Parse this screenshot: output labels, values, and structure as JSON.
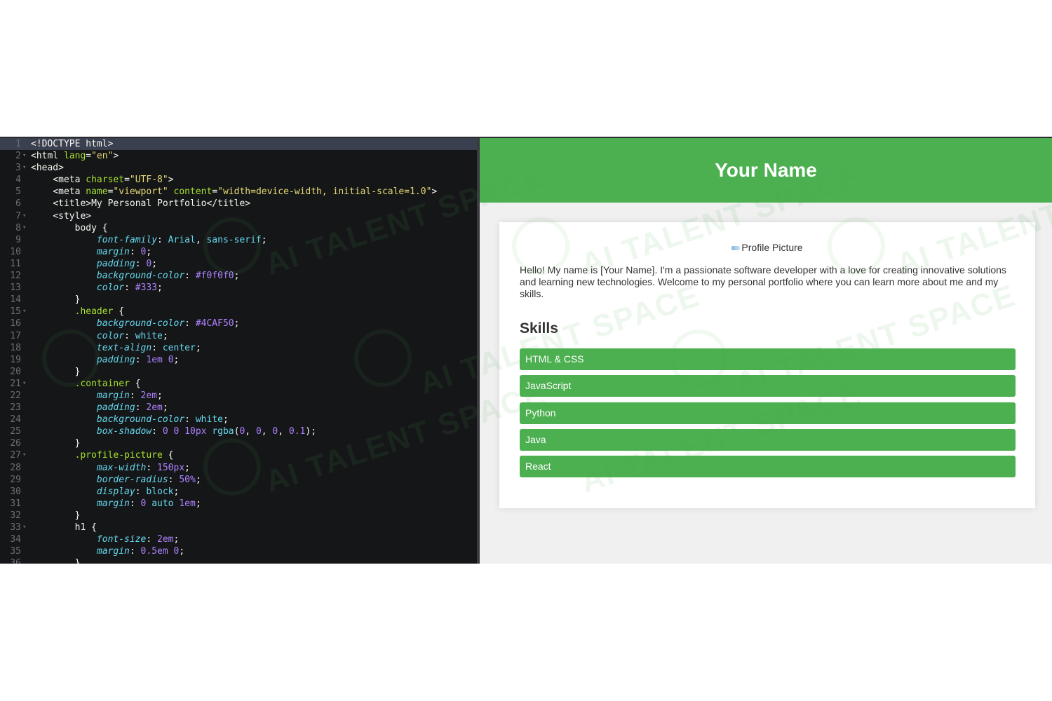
{
  "editor": {
    "lines": [
      {
        "n": "1",
        "fold": "",
        "active": true,
        "html": "<span class='t-tag'>&lt;!DOCTYPE html&gt;</span>"
      },
      {
        "n": "2",
        "fold": "▾",
        "html": "<span class='t-tag'>&lt;html </span><span class='t-attr'>lang</span><span class='t-punc'>=</span><span class='t-str'>\"en\"</span><span class='t-tag'>&gt;</span>"
      },
      {
        "n": "3",
        "fold": "▾",
        "html": "<span class='t-tag'>&lt;head&gt;</span>"
      },
      {
        "n": "4",
        "fold": "",
        "html": "    <span class='t-tag'>&lt;meta </span><span class='t-attr'>charset</span><span class='t-punc'>=</span><span class='t-str'>\"UTF-8\"</span><span class='t-tag'>&gt;</span>"
      },
      {
        "n": "5",
        "fold": "",
        "html": "    <span class='t-tag'>&lt;meta </span><span class='t-attr'>name</span><span class='t-punc'>=</span><span class='t-str'>\"viewport\"</span> <span class='t-attr'>content</span><span class='t-punc'>=</span><span class='t-str'>\"width=device-width, initial-scale=1.0\"</span><span class='t-tag'>&gt;</span>"
      },
      {
        "n": "6",
        "fold": "",
        "html": "    <span class='t-tag'>&lt;title&gt;</span>My Personal Portfolio<span class='t-tag'>&lt;/title&gt;</span>"
      },
      {
        "n": "7",
        "fold": "▾",
        "html": "    <span class='t-tag'>&lt;style&gt;</span>"
      },
      {
        "n": "8",
        "fold": "▾",
        "html": "        <span class='t-tag'>body</span> {"
      },
      {
        "n": "9",
        "fold": "",
        "html": "            <span class='t-prop'>font-family</span>: <span class='t-val'>Arial</span>, <span class='t-val'>sans-serif</span>;"
      },
      {
        "n": "10",
        "fold": "",
        "html": "            <span class='t-prop'>margin</span>: <span class='t-num'>0</span>;"
      },
      {
        "n": "11",
        "fold": "",
        "html": "            <span class='t-prop'>padding</span>: <span class='t-num'>0</span>;"
      },
      {
        "n": "12",
        "fold": "",
        "html": "            <span class='t-prop'>background-color</span>: <span class='t-hex'>#f0f0f0</span>;"
      },
      {
        "n": "13",
        "fold": "",
        "html": "            <span class='t-prop'>color</span>: <span class='t-hex'>#333</span>;"
      },
      {
        "n": "14",
        "fold": "",
        "html": "        }"
      },
      {
        "n": "15",
        "fold": "▾",
        "html": "        <span class='t-sel'>.header</span> {"
      },
      {
        "n": "16",
        "fold": "",
        "html": "            <span class='t-prop'>background-color</span>: <span class='t-hex'>#4CAF50</span>;"
      },
      {
        "n": "17",
        "fold": "",
        "html": "            <span class='t-prop'>color</span>: <span class='t-val'>white</span>;"
      },
      {
        "n": "18",
        "fold": "",
        "html": "            <span class='t-prop'>text-align</span>: <span class='t-val'>center</span>;"
      },
      {
        "n": "19",
        "fold": "",
        "html": "            <span class='t-prop'>padding</span>: <span class='t-num'>1em</span> <span class='t-num'>0</span>;"
      },
      {
        "n": "20",
        "fold": "",
        "html": "        }"
      },
      {
        "n": "21",
        "fold": "▾",
        "html": "        <span class='t-sel'>.container</span> {"
      },
      {
        "n": "22",
        "fold": "",
        "html": "            <span class='t-prop'>margin</span>: <span class='t-num'>2em</span>;"
      },
      {
        "n": "23",
        "fold": "",
        "html": "            <span class='t-prop'>padding</span>: <span class='t-num'>2em</span>;"
      },
      {
        "n": "24",
        "fold": "",
        "html": "            <span class='t-prop'>background-color</span>: <span class='t-val'>white</span>;"
      },
      {
        "n": "25",
        "fold": "",
        "html": "            <span class='t-prop'>box-shadow</span>: <span class='t-num'>0</span> <span class='t-num'>0</span> <span class='t-num'>10px</span> <span class='t-val'>rgba</span>(<span class='t-num'>0</span>, <span class='t-num'>0</span>, <span class='t-num'>0</span>, <span class='t-num'>0.1</span>);"
      },
      {
        "n": "26",
        "fold": "",
        "html": "        }"
      },
      {
        "n": "27",
        "fold": "▾",
        "html": "        <span class='t-sel'>.profile-picture</span> {"
      },
      {
        "n": "28",
        "fold": "",
        "html": "            <span class='t-prop'>max-width</span>: <span class='t-num'>150px</span>;"
      },
      {
        "n": "29",
        "fold": "",
        "html": "            <span class='t-prop'>border-radius</span>: <span class='t-num'>50%</span>;"
      },
      {
        "n": "30",
        "fold": "",
        "html": "            <span class='t-prop'>display</span>: <span class='t-val'>block</span>;"
      },
      {
        "n": "31",
        "fold": "",
        "html": "            <span class='t-prop'>margin</span>: <span class='t-num'>0</span> <span class='t-val'>auto</span> <span class='t-num'>1em</span>;"
      },
      {
        "n": "32",
        "fold": "",
        "html": "        }"
      },
      {
        "n": "33",
        "fold": "▾",
        "html": "        <span class='t-tag'>h1</span> {"
      },
      {
        "n": "34",
        "fold": "",
        "html": "            <span class='t-prop'>font-size</span>: <span class='t-num'>2em</span>;"
      },
      {
        "n": "35",
        "fold": "",
        "html": "            <span class='t-prop'>margin</span>: <span class='t-num'>0.5em</span> <span class='t-num'>0</span>;"
      },
      {
        "n": "36",
        "fold": "",
        "html": "        }"
      }
    ]
  },
  "preview": {
    "header_title": "Your Name",
    "profile_alt": "Profile Picture",
    "intro": "Hello! My name is [Your Name]. I'm a passionate software developer with a love for creating innovative solutions and learning new technologies. Welcome to my personal portfolio where you can learn more about me and my skills.",
    "skills_heading": "Skills",
    "skills": [
      "HTML & CSS",
      "JavaScript",
      "Python",
      "Java",
      "React"
    ]
  },
  "watermark": {
    "text": "AI TALENT SPACE"
  },
  "colors": {
    "accent": "#4CAF50",
    "editor_bg": "#151618",
    "preview_bg": "#f0f0f0"
  }
}
